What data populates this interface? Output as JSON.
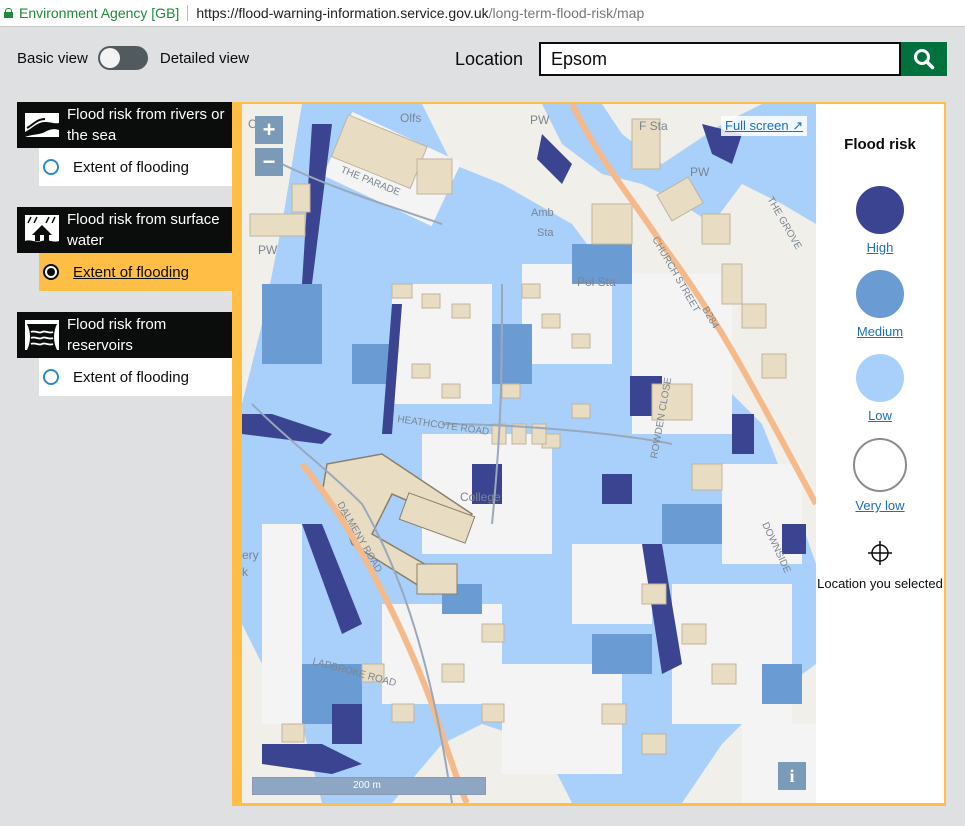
{
  "browser": {
    "site_identity": "Environment Agency [GB]",
    "url_main": "https://flood-warning-information.service.gov.uk",
    "url_path": "/long-term-flood-risk/map"
  },
  "view_toggle": {
    "left_label": "Basic view",
    "right_label": "Detailed view"
  },
  "location": {
    "label": "Location",
    "value": "Epsom",
    "search_icon": "search-icon"
  },
  "layers": [
    {
      "title": "Flood risk from rivers or the sea",
      "icon": "river-icon",
      "option": "Extent of flooding",
      "selected": false
    },
    {
      "title": "Flood risk from surface water",
      "icon": "house-rain-icon",
      "option": "Extent of flooding",
      "selected": true
    },
    {
      "title": "Flood risk from reservoirs",
      "icon": "reservoir-icon",
      "option": "Extent of flooding",
      "selected": false
    }
  ],
  "map": {
    "zoom_in": "+",
    "zoom_out": "−",
    "full_screen": "Full screen",
    "scale": "200 m",
    "info": "i",
    "labels": [
      "Olfs",
      "PW",
      "F Sta",
      "PW",
      "Amb",
      "Sta",
      "Pol Sta",
      "PW",
      "College",
      "CHURCH STREET",
      "THE GROVE",
      "HEATHCOTE ROAD",
      "DALMENY ROAD",
      "LADBROKE ROAD",
      "DOWNSIDE",
      "ROWDEN CLOSE",
      "ery",
      "k",
      "Cl",
      "THE PARADE",
      "B284"
    ]
  },
  "legend": {
    "title": "Flood risk",
    "items": [
      {
        "label": "High",
        "color": "#3b4491",
        "border": "#3b4491"
      },
      {
        "label": "Medium",
        "color": "#6b9bd3",
        "border": "#6b9bd3"
      },
      {
        "label": "Low",
        "color": "#a8d0fb",
        "border": "#a8d0fb"
      },
      {
        "label": "Very low",
        "color": "#ffffff",
        "border": "#8c8c8c"
      }
    ],
    "location_selected": "Location you selected"
  }
}
